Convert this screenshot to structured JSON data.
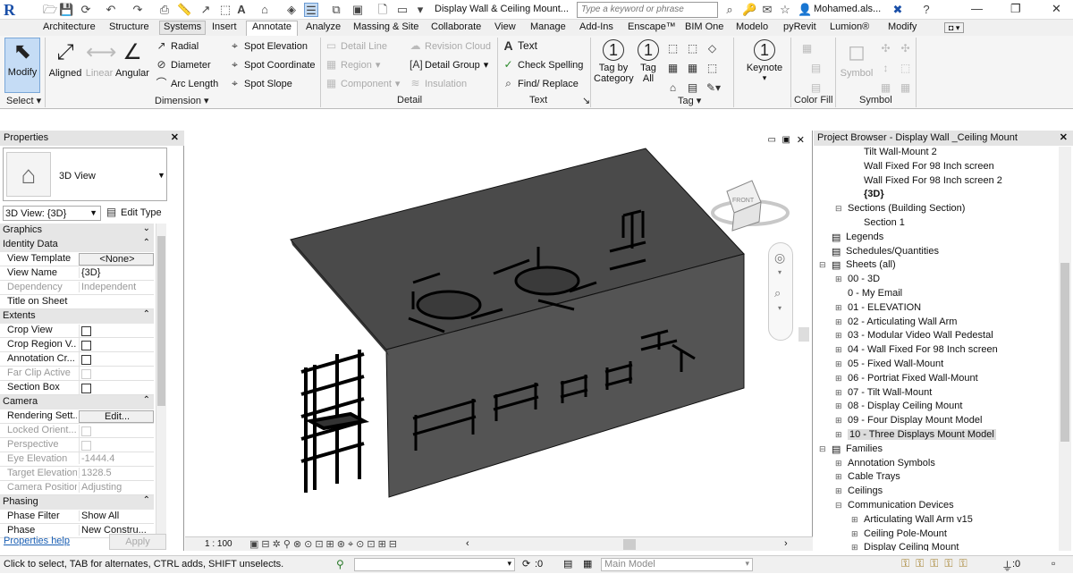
{
  "app": {
    "title": "Display Wall & Ceiling Mount...",
    "search_placeholder": "Type a keyword or phrase",
    "user": "Mohamed.als...",
    "logo": "R"
  },
  "tabs": [
    "Architecture",
    "Structure",
    "Systems",
    "Insert",
    "Annotate",
    "Analyze",
    "Massing & Site",
    "Collaborate",
    "View",
    "Manage",
    "Add-Ins",
    "Enscape™",
    "BIM One",
    "Modelo",
    "pyRevit",
    "Lumion®",
    "Modify"
  ],
  "ribbon": {
    "select": {
      "modify": "Modify",
      "label": "Select"
    },
    "dimension": {
      "aligned": "Aligned",
      "linear": "Linear",
      "angular": "Angular",
      "radial": "Radial",
      "diameter": "Diameter",
      "arc_length": "Arc Length",
      "spot_elevation": "Spot Elevation",
      "spot_coordinate": "Spot Coordinate",
      "spot_slope": "Spot Slope",
      "label": "Dimension"
    },
    "detail": {
      "detail_line": "Detail Line",
      "region": "Region",
      "component": "Component",
      "revision_cloud": "Revision Cloud",
      "detail_group": "Detail Group",
      "insulation": "Insulation",
      "label": "Detail"
    },
    "text": {
      "text": "Text",
      "check_spelling": "Check Spelling",
      "find_replace": "Find/ Replace",
      "label": "Text"
    },
    "tag": {
      "tag_by_category": "Tag by Category",
      "tag_all": "Tag All",
      "keynote": "Keynote",
      "label": "Tag"
    },
    "color_fill": {
      "label": "Color Fill"
    },
    "symbol": {
      "symbol": "Symbol",
      "label": "Symbol"
    }
  },
  "properties": {
    "title": "Properties",
    "type_name": "3D View",
    "instance_selector": "3D View: {3D}",
    "edit_type": "Edit Type",
    "groups": {
      "graphics": "Graphics",
      "identity": "Identity Data",
      "extents": "Extents",
      "camera": "Camera",
      "phasing": "Phasing"
    },
    "rows": {
      "view_template": {
        "k": "View Template",
        "v": "<None>"
      },
      "view_name": {
        "k": "View Name",
        "v": "{3D}"
      },
      "dependency": {
        "k": "Dependency",
        "v": "Independent"
      },
      "title_on_sheet": {
        "k": "Title on Sheet",
        "v": ""
      },
      "crop_view": {
        "k": "Crop View"
      },
      "crop_region": {
        "k": "Crop Region V..."
      },
      "annotation_crop": {
        "k": "Annotation Cr..."
      },
      "far_clip": {
        "k": "Far Clip Active"
      },
      "section_box": {
        "k": "Section Box"
      },
      "rendering": {
        "k": "Rendering Sett...",
        "v": "Edit..."
      },
      "locked": {
        "k": "Locked Orient..."
      },
      "perspective": {
        "k": "Perspective"
      },
      "eye_elev": {
        "k": "Eye Elevation",
        "v": "-1444.4"
      },
      "target_elev": {
        "k": "Target Elevation",
        "v": "1328.5"
      },
      "camera_pos": {
        "k": "Camera Position",
        "v": "Adjusting"
      },
      "phase_filter": {
        "k": "Phase Filter",
        "v": "Show All"
      },
      "phase": {
        "k": "Phase",
        "v": "New Constru..."
      }
    },
    "help": "Properties help",
    "apply": "Apply"
  },
  "viewport": {
    "scale": "1 : 100",
    "viewcube_front": "FRONT"
  },
  "browser": {
    "title": "Project Browser - Display Wall _Ceiling Mount",
    "items": [
      {
        "label": "Tilt Wall-Mount 2",
        "indent": 3
      },
      {
        "label": "Wall Fixed For 98 Inch screen",
        "indent": 3
      },
      {
        "label": "Wall Fixed For 98 Inch screen 2",
        "indent": 3
      },
      {
        "label": "{3D}",
        "indent": 3,
        "bold": true
      },
      {
        "label": "Sections (Building Section)",
        "indent": 2,
        "tog": "−"
      },
      {
        "label": "Section 1",
        "indent": 3
      },
      {
        "label": "Legends",
        "indent": 1,
        "icon": "▤"
      },
      {
        "label": "Schedules/Quantities",
        "indent": 1,
        "icon": "▤"
      },
      {
        "label": "Sheets (all)",
        "indent": 1,
        "tog": "−",
        "icon": "▤"
      },
      {
        "label": "00 - 3D",
        "indent": 2,
        "tog": "+"
      },
      {
        "label": "0 - My Email",
        "indent": 2
      },
      {
        "label": "01 - ELEVATION",
        "indent": 2,
        "tog": "+"
      },
      {
        "label": "02 - Articulating Wall Arm",
        "indent": 2,
        "tog": "+"
      },
      {
        "label": "03 - Modular Video Wall Pedestal",
        "indent": 2,
        "tog": "+"
      },
      {
        "label": "04 - Wall Fixed For 98 Inch screen",
        "indent": 2,
        "tog": "+"
      },
      {
        "label": "05 - Fixed Wall-Mount",
        "indent": 2,
        "tog": "+"
      },
      {
        "label": "06 - Portriat Fixed Wall-Mount",
        "indent": 2,
        "tog": "+"
      },
      {
        "label": "07 - Tilt Wall-Mount",
        "indent": 2,
        "tog": "+"
      },
      {
        "label": "08 - Display Ceiling Mount",
        "indent": 2,
        "tog": "+"
      },
      {
        "label": "09 - Four Display Mount Model",
        "indent": 2,
        "tog": "+"
      },
      {
        "label": "10 - Three Displays Mount Model",
        "indent": 2,
        "tog": "+",
        "selected": true
      },
      {
        "label": "Families",
        "indent": 1,
        "tog": "−",
        "icon": "▤"
      },
      {
        "label": "Annotation Symbols",
        "indent": 2,
        "tog": "+"
      },
      {
        "label": "Cable Trays",
        "indent": 2,
        "tog": "+"
      },
      {
        "label": "Ceilings",
        "indent": 2,
        "tog": "+"
      },
      {
        "label": "Communication Devices",
        "indent": 2,
        "tog": "−"
      },
      {
        "label": "Articulating Wall Arm v15",
        "indent": 3,
        "tog": "+"
      },
      {
        "label": "Ceiling Pole-Mount",
        "indent": 3,
        "tog": "+"
      },
      {
        "label": "Display Ceiling Mount",
        "indent": 3,
        "tog": "+"
      }
    ]
  },
  "status": {
    "message": "Click to select, TAB for alternates, CTRL adds, SHIFT unselects.",
    "workset_count": ":0",
    "model": "Main Model",
    "filter_count": ":0"
  }
}
